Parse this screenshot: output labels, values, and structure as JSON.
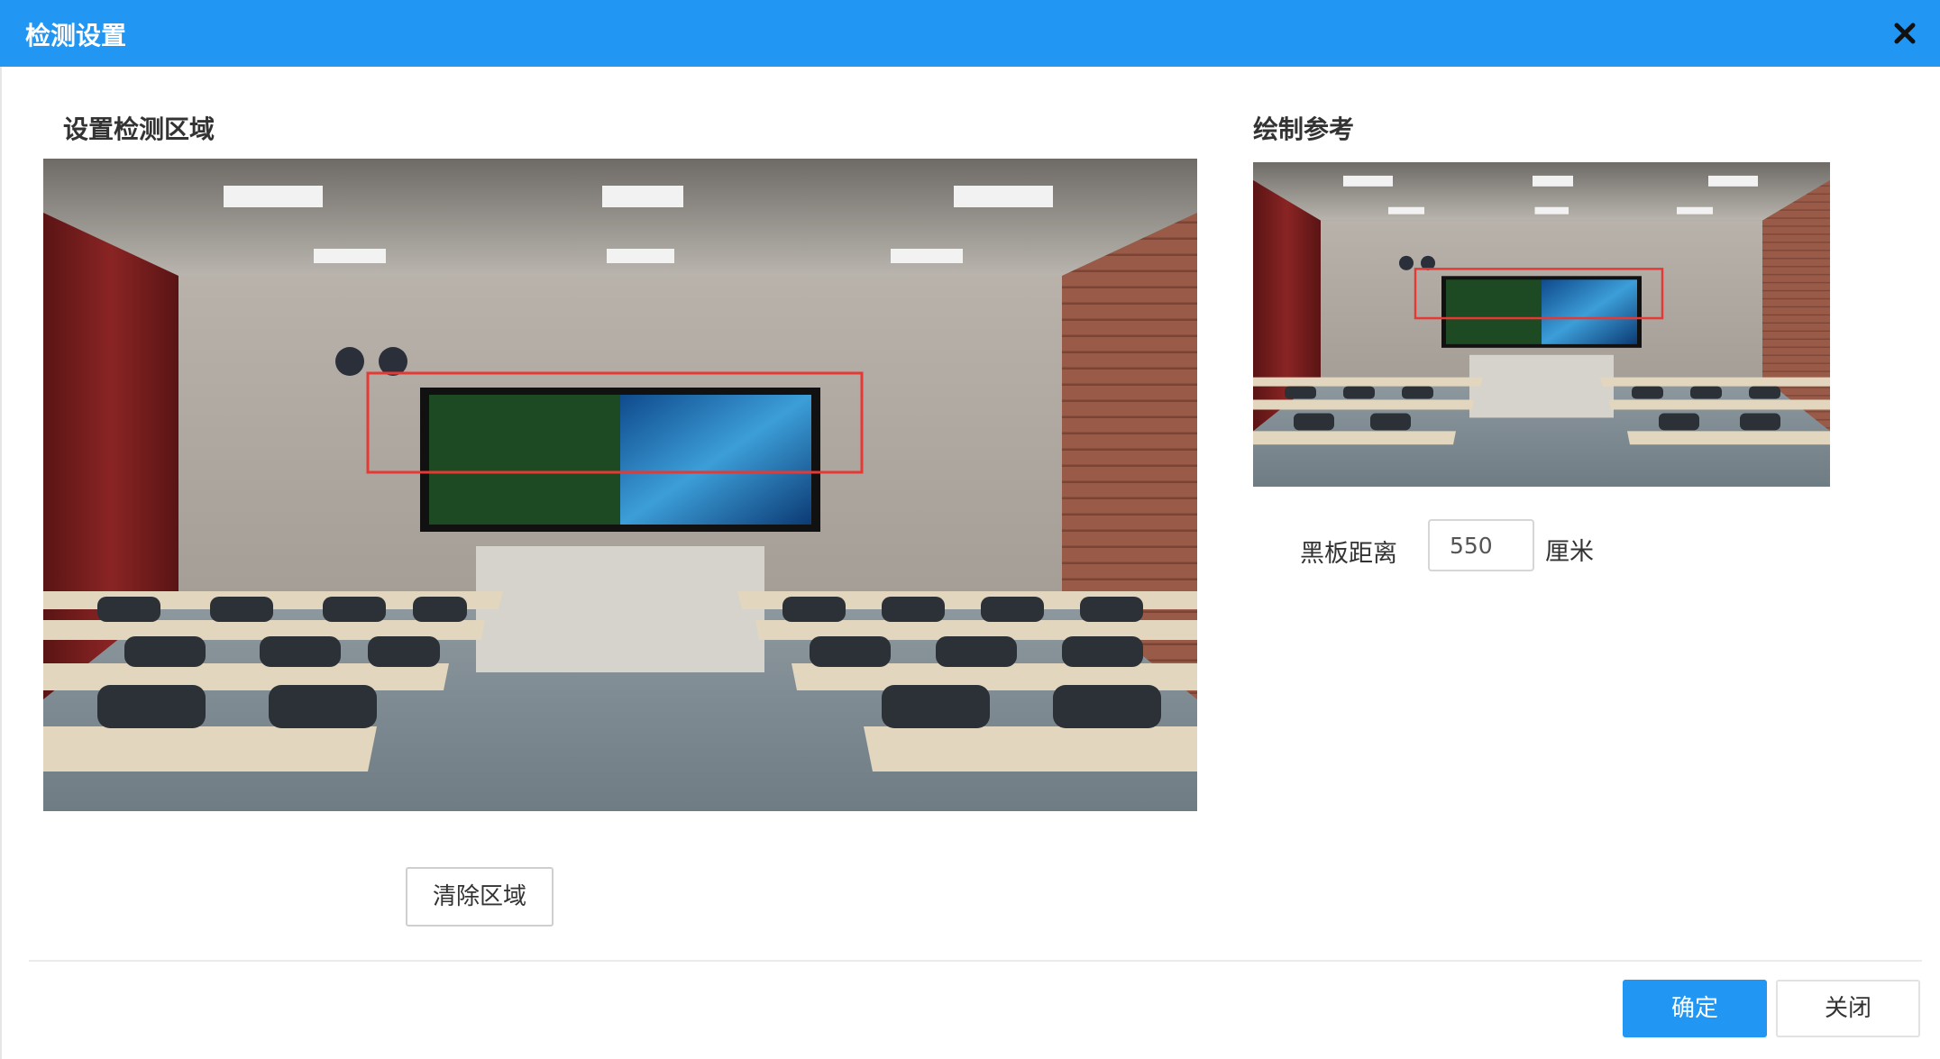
{
  "dialog": {
    "title": "检测设置",
    "close_icon": "close-icon"
  },
  "left_panel": {
    "label": "设置检测区域",
    "image_semantic": "classroom-scene-with-blackboard-and-detection-region",
    "region_color": "#e53935",
    "clear_button_label": "清除区域"
  },
  "right_panel": {
    "label": "绘制参考",
    "image_semantic": "classroom-reference-drawing",
    "distance_label": "黑板距离",
    "distance_value": "550",
    "distance_unit": "厘米"
  },
  "footer": {
    "confirm_label": "确定",
    "close_label": "关闭"
  },
  "colors": {
    "accent": "#2196F3",
    "region": "#e53935"
  }
}
